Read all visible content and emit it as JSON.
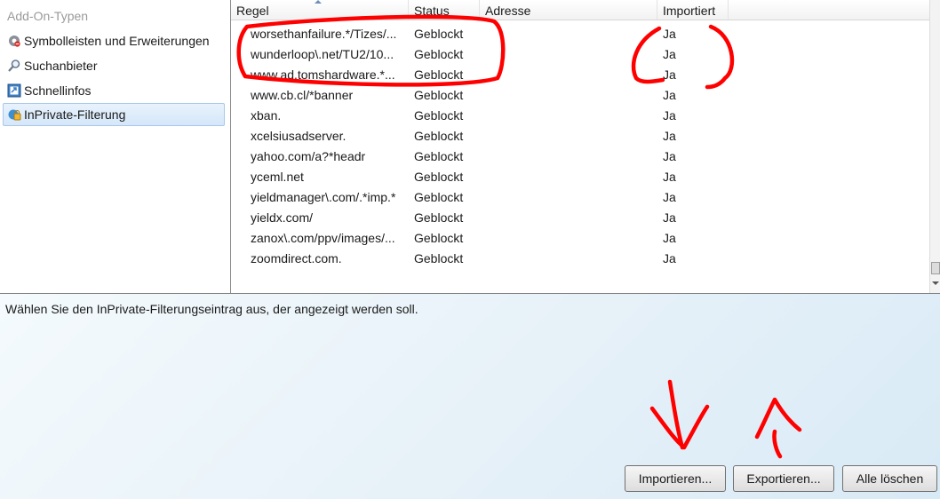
{
  "sidebar": {
    "heading": "Add-On-Typen",
    "items": [
      {
        "label": "Symbolleisten und Erweiterungen",
        "icon": "gear-icon"
      },
      {
        "label": "Suchanbieter",
        "icon": "magnifier-icon"
      },
      {
        "label": "Schnellinfos",
        "icon": "accelerator-icon"
      },
      {
        "label": "InPrivate-Filterung",
        "icon": "inprivate-filter-icon",
        "selected": true
      }
    ]
  },
  "table": {
    "columns": [
      "Regel",
      "Status",
      "Adresse",
      "Importiert"
    ],
    "sorted_column": "Regel",
    "rows": [
      {
        "regel": "worsethanfailure.*/Tizes/...",
        "status": "Geblockt",
        "adresse": "",
        "importiert": "Ja"
      },
      {
        "regel": "wunderloop\\.net/TU2/10...",
        "status": "Geblockt",
        "adresse": "",
        "importiert": "Ja"
      },
      {
        "regel": "www.ad.tomshardware.*...",
        "status": "Geblockt",
        "adresse": "",
        "importiert": "Ja"
      },
      {
        "regel": "www.cb.cl/*banner",
        "status": "Geblockt",
        "adresse": "",
        "importiert": "Ja"
      },
      {
        "regel": "xban.",
        "status": "Geblockt",
        "adresse": "",
        "importiert": "Ja"
      },
      {
        "regel": "xcelsiusadserver.",
        "status": "Geblockt",
        "adresse": "",
        "importiert": "Ja"
      },
      {
        "regel": "yahoo.com/a?*headr",
        "status": "Geblockt",
        "adresse": "",
        "importiert": "Ja"
      },
      {
        "regel": "yceml.net",
        "status": "Geblockt",
        "adresse": "",
        "importiert": "Ja"
      },
      {
        "regel": "yieldmanager\\.com/.*imp.*",
        "status": "Geblockt",
        "adresse": "",
        "importiert": "Ja"
      },
      {
        "regel": "yieldx.com/",
        "status": "Geblockt",
        "adresse": "",
        "importiert": "Ja"
      },
      {
        "regel": "zanox\\.com/ppv/images/...",
        "status": "Geblockt",
        "adresse": "",
        "importiert": "Ja"
      },
      {
        "regel": "zoomdirect.com.",
        "status": "Geblockt",
        "adresse": "",
        "importiert": "Ja"
      }
    ]
  },
  "details": {
    "hint": "Wählen Sie den InPrivate-Filterungseintrag aus, der angezeigt werden soll."
  },
  "buttons": {
    "import": "Importieren...",
    "export": "Exportieren...",
    "clear_all": "Alle löschen"
  },
  "annotations": {
    "color": "#ff0000",
    "marks": [
      "ellipse-around-first-three-rows",
      "parentheses-around-ja-values",
      "arrow-down-to-import-button",
      "arrow-up-from-export-button"
    ]
  }
}
